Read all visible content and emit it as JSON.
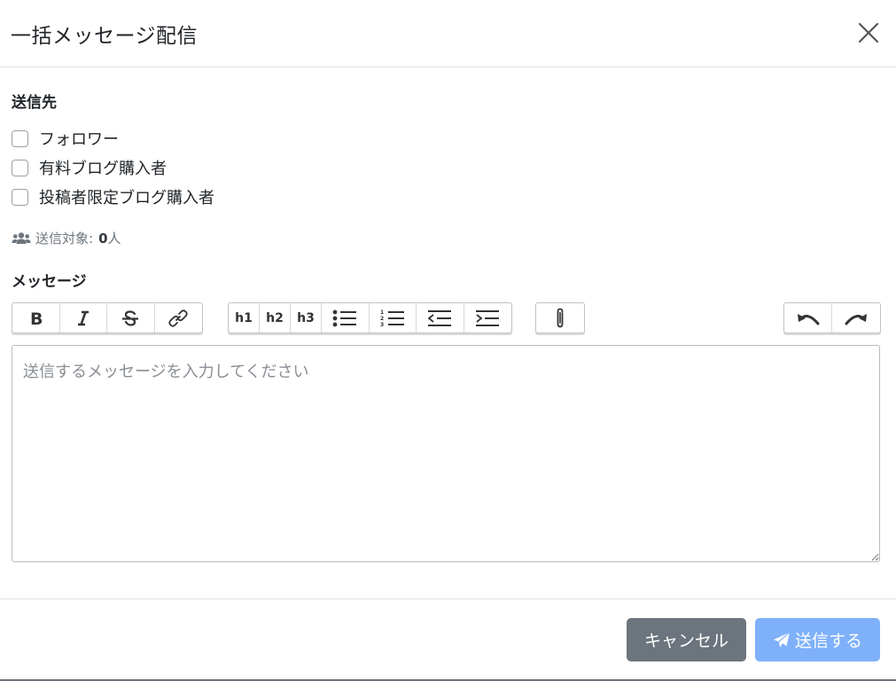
{
  "modal": {
    "title": "一括メッセージ配信"
  },
  "recipients": {
    "label": "送信先",
    "options": [
      {
        "label": "フォロワー",
        "checked": false
      },
      {
        "label": "有料ブログ購入者",
        "checked": false
      },
      {
        "label": "投稿者限定ブログ購入者",
        "checked": false
      }
    ],
    "count_prefix": "送信対象:",
    "count_value": "0",
    "count_unit": "人",
    "count_icon": "users-icon"
  },
  "message": {
    "label": "メッセージ",
    "placeholder": "送信するメッセージを入力してください",
    "toolbar": {
      "format": [
        "bold-icon",
        "italic-icon",
        "strikethrough-icon",
        "link-icon"
      ],
      "headings": [
        "h1",
        "h2",
        "h3"
      ],
      "lists": [
        "bullet-list-icon",
        "numbered-list-icon",
        "outdent-icon",
        "indent-icon"
      ],
      "attach": "paperclip-icon",
      "history": [
        "undo-icon",
        "redo-icon"
      ]
    }
  },
  "footer": {
    "cancel_label": "キャンセル",
    "send_label": "送信する",
    "send_icon": "paper-plane-icon"
  },
  "colors": {
    "cancel_bg": "#6c757d",
    "send_bg": "#7fb1fb",
    "muted_text": "#6c757d"
  }
}
